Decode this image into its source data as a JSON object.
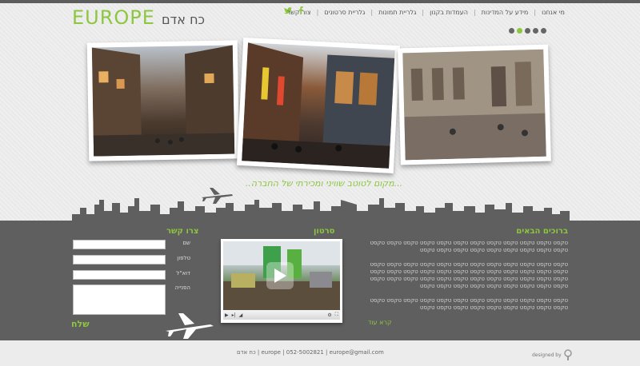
{
  "brand": {
    "logo_main": "EUROPE",
    "logo_sub": "כח אדם",
    "accent": "#8dc63f"
  },
  "nav": {
    "items": [
      "מי אנחנו",
      "מידע על המדינות",
      "העמדות בקנון",
      "גלריית תמונות",
      "גלריית סרטונים",
      "צור קשר"
    ]
  },
  "slider": {
    "dots": 5,
    "active_index": 1
  },
  "slogan": "..מקום לטוטב שוויני ומכירתי של החברה...",
  "news": {
    "title": "ברוכים הבאים",
    "paragraphs": [
      "טקסט טקסט טקסט טקסט טקסט טקסט טקסט טקסט טקסט טקסט טקסט טקסט טקסט טקסט טקסט טקסט טקסט טקסט טקסט טקסט טקסט",
      "טקסט טקסט טקסט טקסט טקסט טקסט טקסט טקסט טקסט טקסט טקסט טקסט טקסט טקסט טקסט טקסט טקסט טקסט טקסט טקסט טקסט טקסט טקסט טקסט טקסט טקסט טקסט טקסט טקסט טקסט טקסט טקסט טקסט טקסט טקסט טקסט טקסט טקסט טקסט טקסט טקסט טקסט טקסט טקסט טקסט",
      "טקסט טקסט טקסט טקסט טקסט טקסט טקסט טקסט טקסט טקסט טקסט טקסט טקסט טקסט טקסט טקסט טקסט טקסט טקסט טקסט טקסט"
    ],
    "readmore": "קרא עוד"
  },
  "video": {
    "title": "סרטון"
  },
  "contact": {
    "title": "צרו קשר",
    "labels": [
      "שם",
      "טלפון",
      "דוא\"ל",
      "הפנייה"
    ],
    "send": "שלח"
  },
  "footer": {
    "copyright": "כח אדם | europe | 052-5002821 | europe@gmail.com",
    "designed_by": "designed by"
  }
}
